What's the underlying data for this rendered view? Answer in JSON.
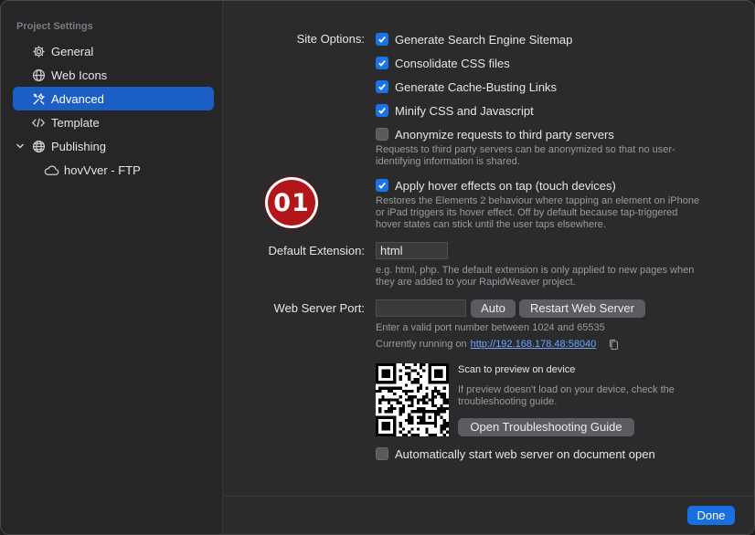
{
  "sidebar": {
    "header": "Project Settings",
    "items": [
      {
        "label": "General",
        "icon": "gear-icon"
      },
      {
        "label": "Web Icons",
        "icon": "globe-icon"
      },
      {
        "label": "Advanced",
        "icon": "tools-icon",
        "active": true
      },
      {
        "label": "Template",
        "icon": "code-icon"
      },
      {
        "label": "Publishing",
        "icon": "globe-icon",
        "expanded": true
      },
      {
        "label": "hovVver - FTP",
        "icon": "cloud-icon"
      }
    ]
  },
  "site_options": {
    "label": "Site Options:",
    "options": [
      {
        "label": "Generate Search Engine Sitemap",
        "checked": true
      },
      {
        "label": "Consolidate CSS files",
        "checked": true
      },
      {
        "label": "Generate Cache-Busting Links",
        "checked": true
      },
      {
        "label": "Minify CSS and Javascript",
        "checked": true
      },
      {
        "label": "Anonymize requests to third party servers",
        "checked": false,
        "help": [
          "Requests to third party servers can be anonymized so that no user-",
          "identifying information is shared."
        ]
      },
      {
        "label": "Apply hover effects on tap (touch devices)",
        "checked": true,
        "help": [
          "Restores the Elements 2 behaviour where tapping an element on iPhone",
          "or iPad triggers its hover effect. Off by default because tap-triggered",
          "hover states can stick until the user taps elsewhere."
        ]
      }
    ]
  },
  "badge": {
    "text": "01",
    "color": "#b3161a"
  },
  "default_extension": {
    "label": "Default Extension:",
    "value": "html",
    "help": [
      "e.g. html, php. The default extension is only applied to new pages when",
      "they are added to your RapidWeaver project."
    ]
  },
  "web_server": {
    "label": "Web Server Port:",
    "port_value": "",
    "auto_label": "Auto",
    "restart_label": "Restart Web Server",
    "help": "Enter a valid port number between 1024 and 65535",
    "running_prefix": "Currently running on",
    "url": "http://192.168.178.48:58040"
  },
  "preview": {
    "title": "Scan to preview on device",
    "help": [
      "If preview doesn't load on your device, check the",
      "troubleshooting guide."
    ],
    "button_label": "Open Troubleshooting Guide"
  },
  "autostart": {
    "label": "Automatically start web server on document open",
    "checked": false
  },
  "footer": {
    "done_label": "Done"
  },
  "colors": {
    "accent": "#1a74e8",
    "selection": "#1b5fc6",
    "badge_red": "#b3161a"
  }
}
